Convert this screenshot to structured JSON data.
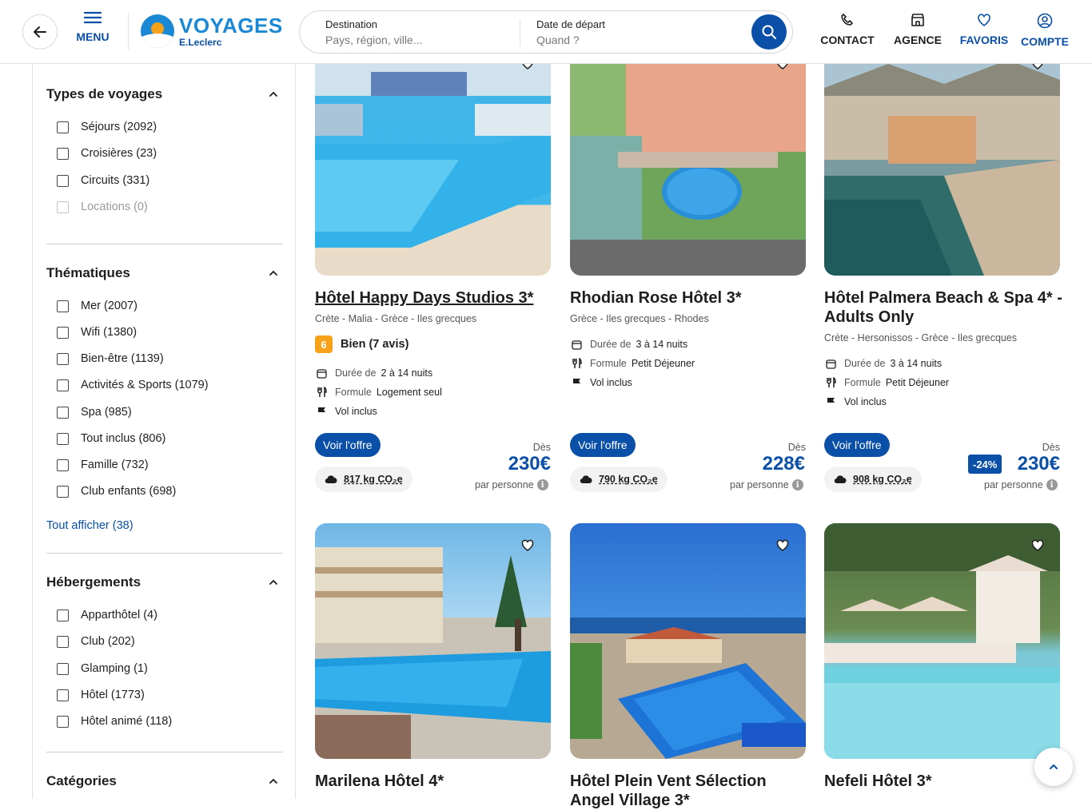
{
  "header": {
    "menu_label": "MENU",
    "logo_brand": "VOYAGES",
    "logo_sub": "E.Leclerc",
    "search": {
      "destination_title": "Destination",
      "destination_placeholder": "Pays, région, ville...",
      "date_title": "Date de départ",
      "date_placeholder": "Quand ?"
    },
    "nav": [
      {
        "label": "CONTACT",
        "icon": "phone-icon"
      },
      {
        "label": "AGENCE",
        "icon": "store-icon"
      },
      {
        "label": "FAVORIS",
        "icon": "heart-icon"
      },
      {
        "label": "COMPTE",
        "icon": "user-icon"
      }
    ]
  },
  "filters": {
    "types": {
      "title": "Types de voyages",
      "options": [
        "Séjours (2092)",
        "Croisières (23)",
        "Circuits (331)",
        "Locations (0)"
      ]
    },
    "themes": {
      "title": "Thématiques",
      "options": [
        "Mer (2007)",
        "Wifi (1380)",
        "Bien-être (1139)",
        "Activités & Sports (1079)",
        "Spa (985)",
        "Tout inclus (806)",
        "Famille (732)",
        "Club enfants (698)"
      ],
      "show_all": "Tout afficher (38)"
    },
    "lodging": {
      "title": "Hébergements",
      "options": [
        "Apparthôtel (4)",
        "Club (202)",
        "Glamping (1)",
        "Hôtel (1773)",
        "Hôtel animé (118)"
      ]
    },
    "categories": {
      "title": "Catégories"
    }
  },
  "offers": [
    {
      "title": "Hôtel Happy Days Studios 3*",
      "location": "Crète - Malia - Grèce - Iles grecques",
      "rating_score": "6",
      "rating_text": "Bien (7 avis)",
      "duration_label": "Durée de",
      "duration": "2 à 14 nuits",
      "board_label": "Formule",
      "board": "Logement seul",
      "flight": "Vol inclus",
      "cta": "Voir l'offre",
      "co2": "817 kg CO₂e",
      "from": "Dès",
      "price": "230€",
      "per": "par personne"
    },
    {
      "title": "Rhodian Rose Hôtel 3*",
      "location": "Grèce - Iles grecques - Rhodes",
      "duration_label": "Durée de",
      "duration": "3 à 14 nuits",
      "board_label": "Formule",
      "board": "Petit Déjeuner",
      "flight": "Vol inclus",
      "cta": "Voir l'offre",
      "co2": "790 kg CO₂e",
      "from": "Dès",
      "price": "228€",
      "per": "par personne"
    },
    {
      "title": "Hôtel Palmera Beach & Spa 4* - Adults Only",
      "location": "Crète - Hersonissos - Grèce - Iles grecques",
      "duration_label": "Durée de",
      "duration": "3 à 14 nuits",
      "board_label": "Formule",
      "board": "Petit Déjeuner",
      "flight": "Vol inclus",
      "cta": "Voir l'offre",
      "co2": "908 kg CO₂e",
      "from": "Dès",
      "discount": "-24%",
      "price": "230€",
      "per": "par personne"
    },
    {
      "title": "Marilena Hôtel 4*"
    },
    {
      "title": "Hôtel Plein Vent Sélection Angel Village 3*"
    },
    {
      "title": "Nefeli Hôtel 3*"
    }
  ],
  "colors": {
    "primary": "#0a4fa8",
    "accent": "#1a88d4",
    "rating": "#f7a11a"
  }
}
